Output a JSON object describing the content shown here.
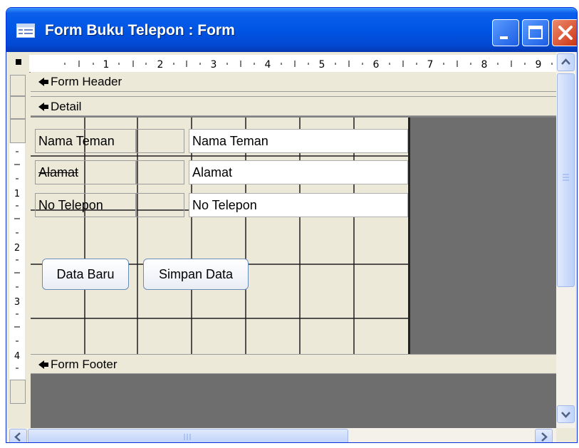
{
  "window": {
    "title": "Form Buku Telepon : Form",
    "title_icon": "form-icon"
  },
  "ruler": {
    "top_numbers": [
      "1",
      "2",
      "3",
      "4",
      "5",
      "6",
      "7",
      "8",
      "9"
    ],
    "left_numbers": [
      "1",
      "2",
      "3",
      "4"
    ]
  },
  "sections": {
    "header": "Form Header",
    "detail": "Detail",
    "footer": "Form Footer"
  },
  "fields": [
    {
      "label": "Nama Teman",
      "control": "Nama Teman"
    },
    {
      "label": "Alamat",
      "control": "Alamat"
    },
    {
      "label": "No Telepon",
      "control": "No Telepon"
    }
  ],
  "buttons": {
    "new_data": "Data Baru",
    "save_data": "Simpan Data"
  },
  "colors": {
    "titlebar": "#0055E5",
    "window_face": "#ECE9D8",
    "grid_line": "#1E1E1E",
    "background_gray": "#6E6E6E"
  }
}
